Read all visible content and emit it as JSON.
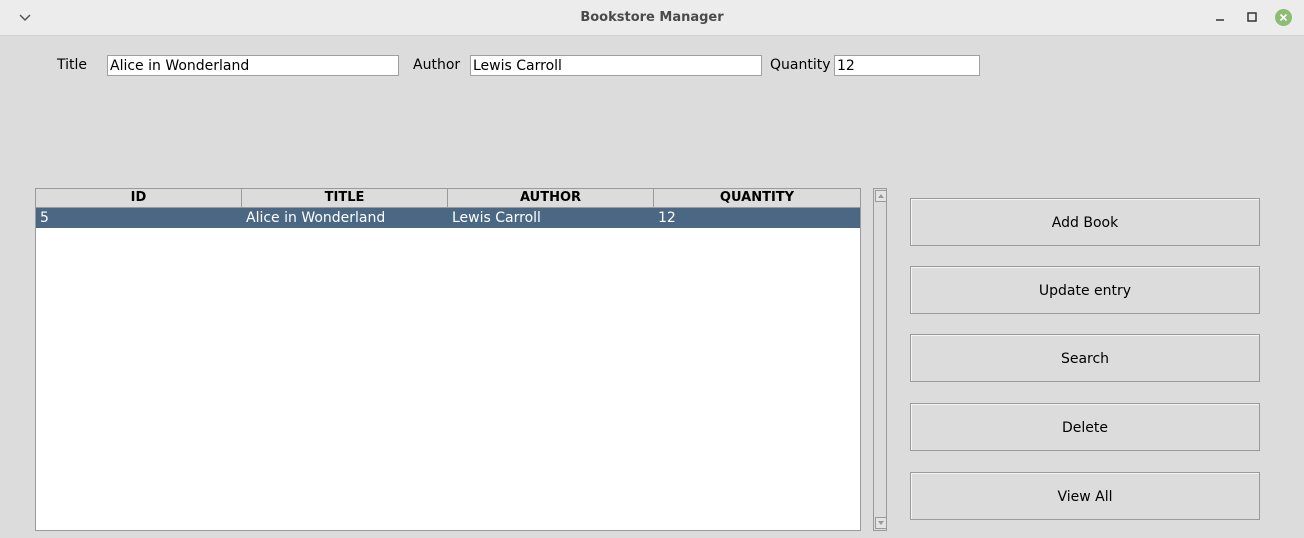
{
  "window": {
    "title": "Bookstore Manager",
    "controls": {
      "menu": "chevron-down-icon",
      "minimize": "minimize-icon",
      "maximize": "maximize-icon",
      "close": "close-icon"
    },
    "close_color": "#8cbd74"
  },
  "form": {
    "title_label": "Title",
    "title_value": "Alice in Wonderland",
    "author_label": "Author",
    "author_value": "Lewis Carroll",
    "quantity_label": "Quantity",
    "quantity_value": "12"
  },
  "table": {
    "columns": [
      "ID",
      "TITLE",
      "AUTHOR",
      "QUANTITY"
    ],
    "rows": [
      {
        "id": "5",
        "title": "Alice in Wonderland",
        "author": "Lewis Carroll",
        "quantity": "12",
        "selected": true
      }
    ],
    "selection_color": "#4a6883"
  },
  "buttons": {
    "add": "Add Book",
    "update": "Update entry",
    "search": "Search",
    "delete": "Delete",
    "view_all": "View All"
  }
}
